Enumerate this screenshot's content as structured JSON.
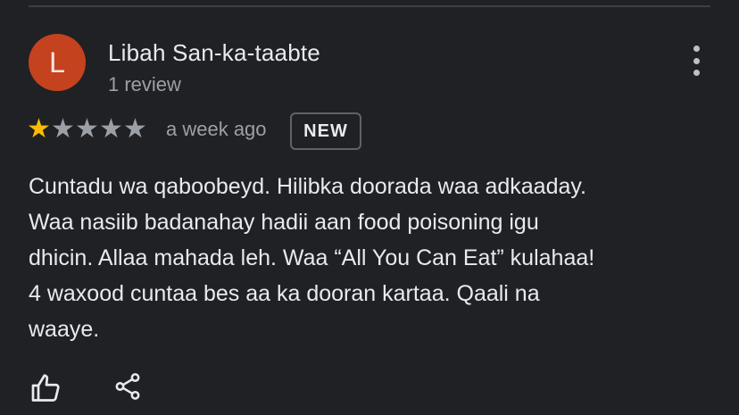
{
  "reviewer": {
    "initial": "L",
    "name": "Libah San-ka-taabte",
    "review_count": "1 review",
    "avatar_color": "#c5421f"
  },
  "rating": {
    "value": 1,
    "max": 5,
    "filled_color": "#fbbc04",
    "empty_color": "#9aa0a6"
  },
  "date": "a week ago",
  "badge": "NEW",
  "review_text_lines": [
    "Cuntadu wa qaboobeyd. Hilibka doorada waa adkaaday.",
    "Waa nasiib badanahay hadii aan food poisoning igu",
    "dhicin. Allaa mahada leh. Waa “All You Can Eat” kulahaa!",
    "4 waxood cuntaa bes aa ka dooran kartaa. Qaali na",
    "waaye."
  ],
  "actions": {
    "like_icon": "thumbs-up-icon",
    "share_icon": "share-icon",
    "more_icon": "more-vert-icon"
  }
}
